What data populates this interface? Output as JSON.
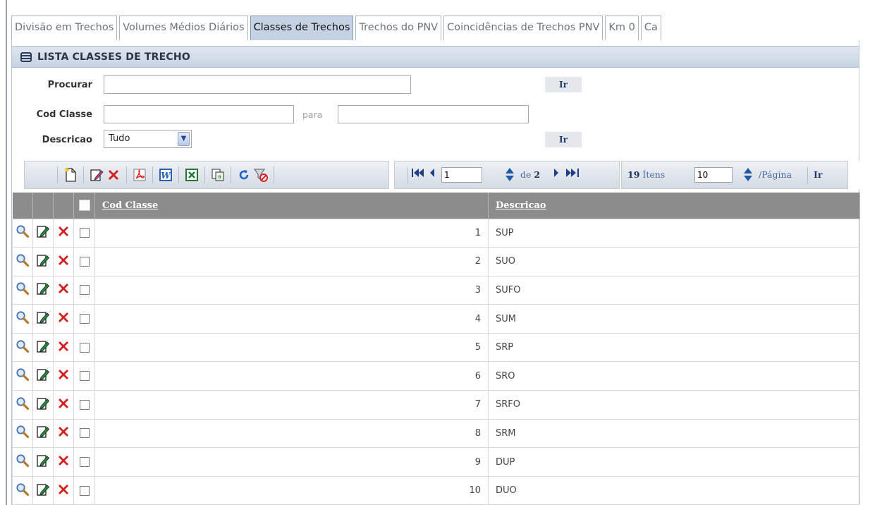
{
  "tabs": [
    {
      "label": "Divisão em Trechos",
      "active": false
    },
    {
      "label": "Volumes Médios Diários",
      "active": false
    },
    {
      "label": "Classes de Trechos",
      "active": true
    },
    {
      "label": "Trechos do PNV",
      "active": false
    },
    {
      "label": "Coincidências de Trechos PNV",
      "active": false
    },
    {
      "label": "Km 0",
      "active": false
    },
    {
      "label": "Ca",
      "active": false
    }
  ],
  "panel": {
    "title": "LISTA CLASSES DE TRECHO"
  },
  "filters": {
    "procurar_label": "Procurar",
    "procurar_value": "",
    "cod_classe_label": "Cod Classe",
    "cod_classe_from": "",
    "para_label": "para",
    "cod_classe_to": "",
    "descricao_label": "Descricao",
    "descricao_selected": "Tudo",
    "go_label": "Ir"
  },
  "toolbar": {
    "icons": [
      "new-icon",
      "edit-icon",
      "delete-icon",
      "pdf-icon",
      "word-icon",
      "excel-icon",
      "copy-icon",
      "refresh-icon",
      "clear-filter-icon"
    ],
    "current_page": "1",
    "de_label": "de",
    "total_pages": "2",
    "items_count": "19",
    "items_label": "Ítens",
    "per_page": "10",
    "per_page_label": "/Página",
    "go_label": "Ir"
  },
  "table": {
    "columns": [
      "Cod Classe",
      "Descricao"
    ],
    "rows": [
      {
        "cod": "1",
        "desc": "SUP"
      },
      {
        "cod": "2",
        "desc": "SUO"
      },
      {
        "cod": "3",
        "desc": "SUFO"
      },
      {
        "cod": "4",
        "desc": "SUM"
      },
      {
        "cod": "5",
        "desc": "SRP"
      },
      {
        "cod": "6",
        "desc": "SRO"
      },
      {
        "cod": "7",
        "desc": "SRFO"
      },
      {
        "cod": "8",
        "desc": "SRM"
      },
      {
        "cod": "9",
        "desc": "DUP"
      },
      {
        "cod": "10",
        "desc": "DUO"
      }
    ]
  },
  "colors": {
    "header_bg": "#8c8c8c",
    "tab_active_bg": "#c5d2e4",
    "delete_red": "#d42020",
    "link_blue": "#1e3f86"
  }
}
